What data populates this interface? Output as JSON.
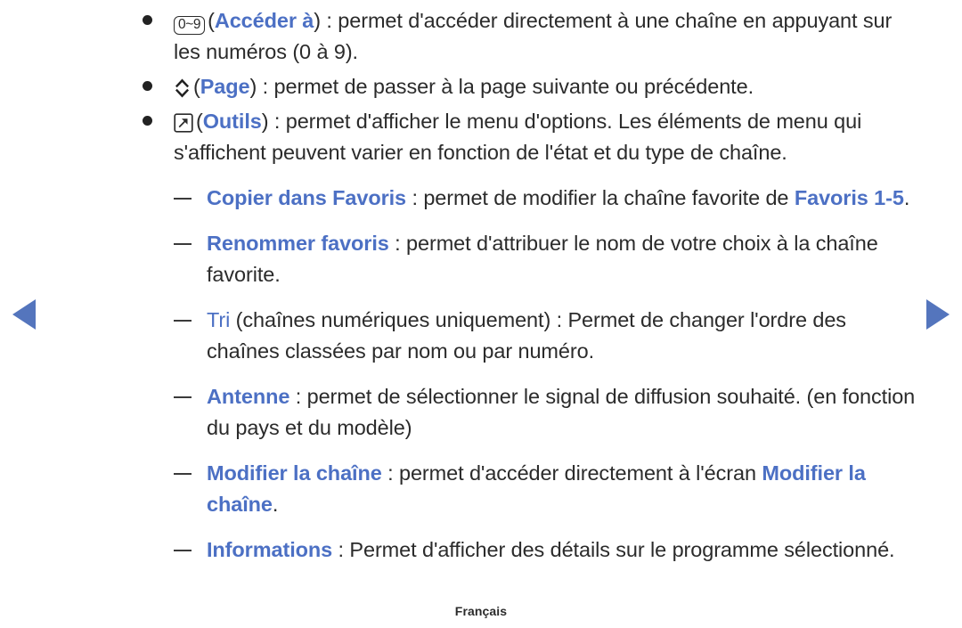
{
  "nav": {
    "prev_label": "Page précédente",
    "next_label": "Page suivante",
    "arrow_color": "#5475bd"
  },
  "theme": {
    "highlight_color": "#4c70c4",
    "text_color": "#2b2b2b",
    "background": "#ffffff"
  },
  "bullets": [
    {
      "icon": "numeric-keys-icon",
      "icon_text": "0~9",
      "term": "Accéder à",
      "line1_pre": "(",
      "line1_post": ") : permet d'accéder directement à une chaîne en",
      "line2": "appuyant sur les numéros (0 à 9)."
    },
    {
      "icon": "page-up-down-icon",
      "icon_text": "",
      "term": "Page",
      "line1_pre": "(",
      "line1_post": ") : permet de passer à la page suivante ou précédente.",
      "line2": ""
    },
    {
      "icon": "tools-icon",
      "icon_text": "",
      "term": "Outils",
      "line1_pre": "(",
      "line1_post": ") : permet d'afficher le menu d'options. Les éléments de menu",
      "line2": "qui s'affichent peuvent varier en fonction de l'état et du type de chaîne."
    }
  ],
  "sub_items": [
    {
      "term": "Copier dans Favoris",
      "body_a": " : permet de modifier la chaîne favorite de ",
      "emphasis": "Favoris 1-5",
      "body_b": "."
    },
    {
      "term": "Renommer favoris",
      "body_a": " : permet d'attribuer le nom de votre choix à la chaîne favorite.",
      "emphasis": "",
      "body_b": ""
    },
    {
      "term": "Tri",
      "term_plain": true,
      "body_a": " (chaînes numériques uniquement) : Permet de changer l'ordre des chaînes classées par nom ou par numéro.",
      "emphasis": "",
      "body_b": ""
    },
    {
      "term": "Antenne",
      "body_a": " : permet de sélectionner le signal de diffusion souhaité. (en fonction du pays et du modèle)",
      "emphasis": "",
      "body_b": ""
    },
    {
      "term": "Modifier la chaîne",
      "body_a": " : permet d'accéder directement à l'écran ",
      "emphasis": "Modifier la chaîne",
      "body_b": "."
    },
    {
      "term": "Informations",
      "body_a": " : Permet d'afficher des détails sur le programme sélectionné.",
      "emphasis": "",
      "body_b": ""
    }
  ],
  "footer": {
    "language": "Français"
  }
}
